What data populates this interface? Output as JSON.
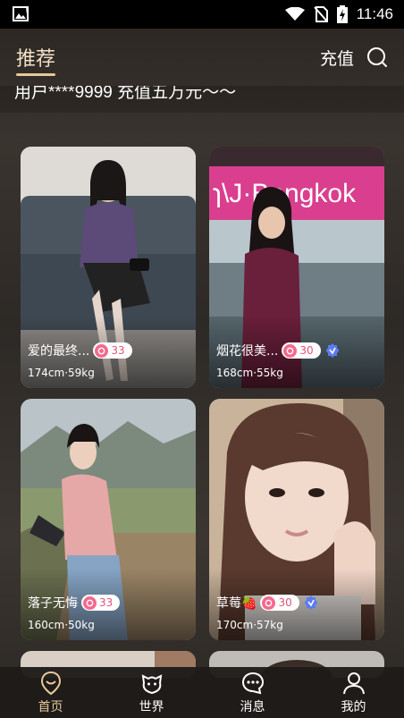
{
  "status_bar": {
    "time": "11:46"
  },
  "header": {
    "title": "推荐",
    "recharge_label": "充值"
  },
  "notice": {
    "text": "用户****9999 充值五万元〜〜"
  },
  "cards": [
    {
      "name": "爱的最终...",
      "level": "33",
      "stats": "174cm·59kg",
      "verified": false
    },
    {
      "name": "烟花很美...",
      "level": "30",
      "stats": "168cm·55kg",
      "verified": true
    },
    {
      "name": "落子无悔",
      "level": "33",
      "stats": "160cm·50kg",
      "verified": false
    },
    {
      "name": "草莓🍓",
      "level": "30",
      "stats": "170cm·57kg",
      "verified": true
    }
  ],
  "nav": {
    "home": "首页",
    "world": "世界",
    "messages": "消息",
    "mine": "我的"
  },
  "colors": {
    "accent": "#e7c89a",
    "badge": "#e0557a",
    "verified": "#5b7cf0"
  }
}
